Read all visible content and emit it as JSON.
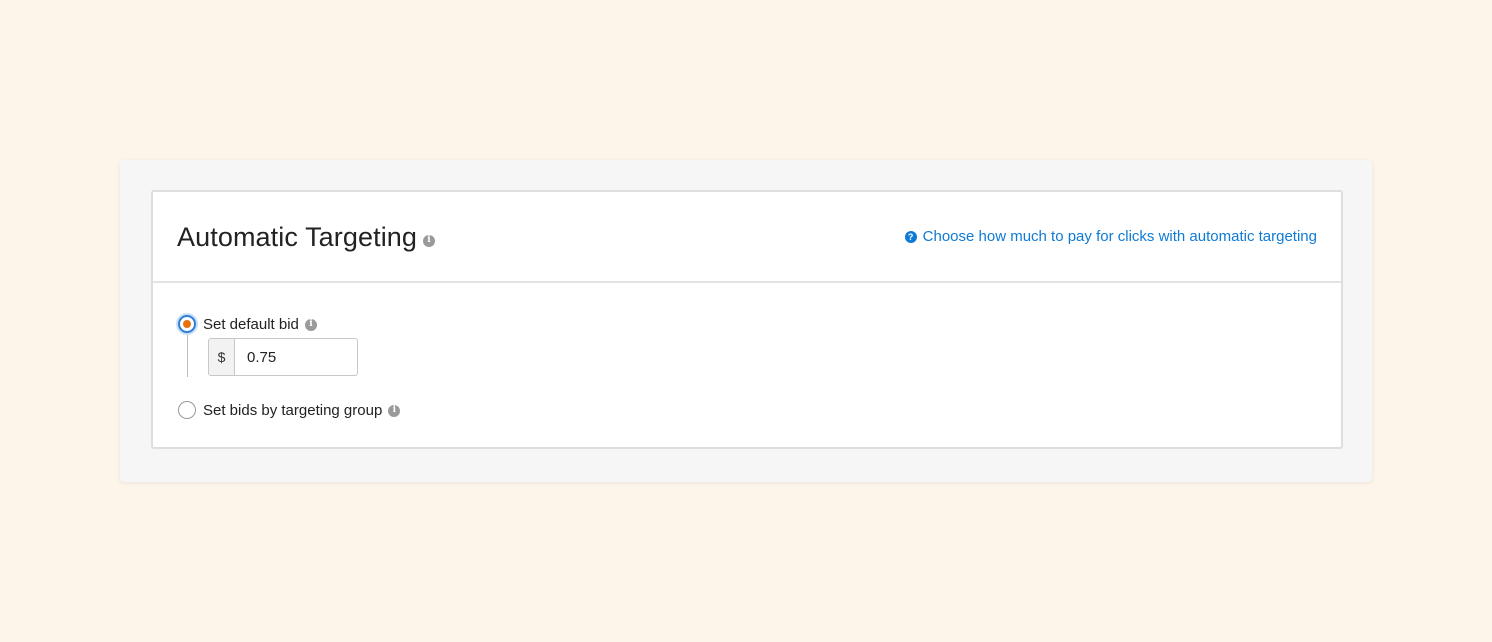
{
  "panel": {
    "title": "Automatic Targeting",
    "help_link": "Choose how much to pay for clicks with automatic targeting",
    "help_icon_glyph": "?",
    "info_icon_glyph": "i"
  },
  "options": {
    "default_bid": {
      "label": "Set default bid",
      "selected": true,
      "currency_symbol": "$",
      "value": "0.75"
    },
    "targeting_group": {
      "label": "Set bids by targeting group",
      "selected": false
    }
  },
  "icons": {
    "title_info": "info-icon",
    "help": "help-circle-icon",
    "default_bid_info": "info-icon",
    "targeting_group_info": "info-icon"
  },
  "colors": {
    "link": "#0f7ad6",
    "radio_selected_ring": "#2f7fd6",
    "radio_selected_dot": "#e7730f",
    "page_background": "#fdf5ea"
  }
}
